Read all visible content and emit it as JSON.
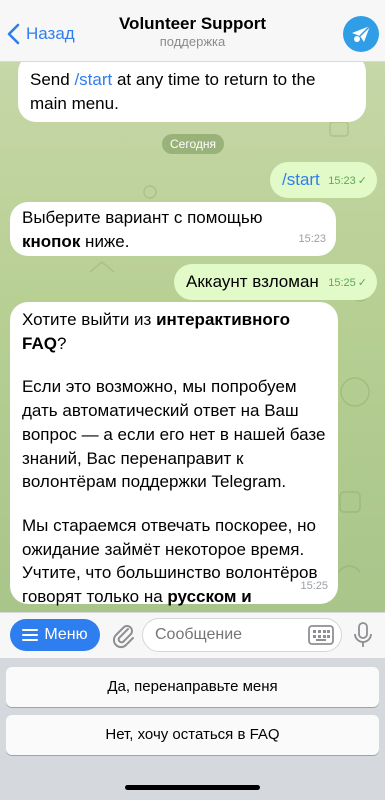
{
  "header": {
    "back_label": "Назад",
    "title": "Volunteer Support",
    "subtitle": "поддержка"
  },
  "chat": {
    "messages": [
      {
        "direction": "in",
        "text_before": "Send ",
        "link": "/start",
        "text_after": " at any time to return to the main menu."
      },
      {
        "direction": "date",
        "text": "Сегодня"
      },
      {
        "direction": "out",
        "text": "/start",
        "time": "15:23"
      },
      {
        "direction": "in",
        "text_before": "Выберите вариант с помощью ",
        "bold": "кнопок",
        "text_after": " ниже.",
        "time": "15:23"
      },
      {
        "direction": "out",
        "text": "Аккаунт взломан",
        "time": "15:25"
      },
      {
        "direction": "in",
        "p1_before": "Хотите выйти из ",
        "p1_bold": "интерактивного FAQ",
        "p1_after": "?",
        "p2": "Если это возможно, мы попробуем дать автоматический ответ на Ваш вопрос — а если его нет в нашей базе знаний, Вас перенаправит к волонтёрам поддержки Telegram.",
        "p3_before": "Мы стараемся отвечать поскорее, но ожидание займёт некоторое время. Учтите, что большинство волонтёров говорят только на ",
        "p3_bold": "русском и английском",
        "p3_after": ".",
        "time": "15:25"
      }
    ]
  },
  "input": {
    "menu_label": "Меню",
    "placeholder": "Сообщение"
  },
  "keyboard": {
    "buttons": [
      "Да, перенаправьте меня",
      "Нет, хочу остаться в FAQ"
    ]
  },
  "colors": {
    "accent": "#2f7ef0",
    "outgoing_bubble": "#e2fac8",
    "incoming_bubble": "#ffffff",
    "chat_background": "#b7cf93"
  },
  "icons": [
    "chevron-left-icon",
    "paper-plane-avatar-icon",
    "menu-lines-icon",
    "paperclip-icon",
    "keyboard-icon",
    "microphone-icon",
    "double-check-icon"
  ]
}
